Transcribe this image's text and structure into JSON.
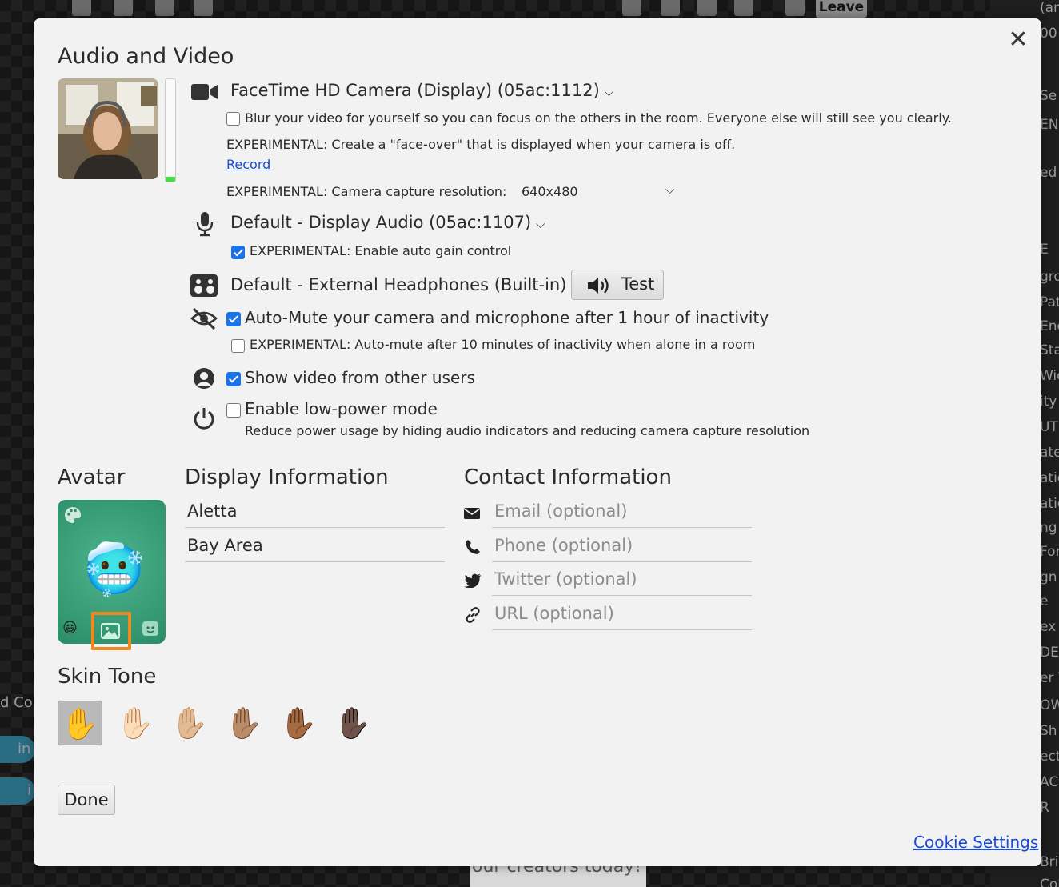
{
  "background": {
    "leave_label": "Leave",
    "right_words": [
      "(arrow)",
      "00",
      "Se",
      "EN",
      "ed",
      "E",
      "gro",
      "Path",
      "Enc",
      "Star",
      "Wic",
      "ity",
      "UT",
      "ate",
      "atio",
      "atio",
      "ng",
      "For",
      "gn",
      "e",
      "ex",
      "DEF",
      "er V",
      "OW",
      "Sh",
      "ect",
      "AC",
      "R",
      "Brightne",
      "Color M"
    ],
    "left_words": [
      "d Co",
      "in",
      "i"
    ],
    "bottom_text": "our creators today!"
  },
  "modal": {
    "title": "Audio and Video",
    "close_label": "✕",
    "meter_level": 0.05,
    "camera": {
      "device": "FaceTime HD Camera (Display) (05ac:1112)",
      "blur_label": "Blur your video for yourself so you can focus on the others in the room. Everyone else will still see you clearly.",
      "blur_checked": false,
      "faceover_label": "EXPERIMENTAL: Create a \"face-over\" that is displayed when your camera is off.",
      "record_link": "Record",
      "resolution_label": "EXPERIMENTAL: Camera capture resolution:",
      "resolution_value": "640x480"
    },
    "microphone": {
      "device": "Default - Display Audio (05ac:1107)",
      "agc_label": "EXPERIMENTAL: Enable auto gain control",
      "agc_checked": true
    },
    "speaker": {
      "device": "Default - External Headphones (Built-in)",
      "test_label": "Test"
    },
    "automute": {
      "label": "Auto-Mute your camera and microphone after 1 hour of inactivity",
      "checked": true,
      "alone_label": "EXPERIMENTAL: Auto-mute after 10 minutes of inactivity when alone in a room",
      "alone_checked": false
    },
    "show_video": {
      "label": "Show video from other users",
      "checked": true
    },
    "low_power": {
      "label": "Enable low-power mode",
      "checked": false,
      "description": "Reduce power usage by hiding audio indicators and reducing camera capture resolution"
    }
  },
  "avatar": {
    "title": "Avatar",
    "emoji": "🥶"
  },
  "display_info": {
    "title": "Display Information",
    "name": "Aletta",
    "location": "Bay Area"
  },
  "contact_info": {
    "title": "Contact Information",
    "email_placeholder": "Email (optional)",
    "phone_placeholder": "Phone (optional)",
    "twitter_placeholder": "Twitter (optional)",
    "url_placeholder": "URL (optional)"
  },
  "skin_tone": {
    "title": "Skin Tone",
    "tones": [
      "✋",
      "✋🏻",
      "✋🏼",
      "✋🏽",
      "✋🏾",
      "✋🏿"
    ],
    "selected_index": 0
  },
  "footer": {
    "done_label": "Done",
    "cookie_label": "Cookie Settings"
  },
  "colors": {
    "accent": "#1a73e8",
    "link": "#1a4bd6",
    "highlight": "#f08a1f",
    "meter": "#3ee03e"
  }
}
